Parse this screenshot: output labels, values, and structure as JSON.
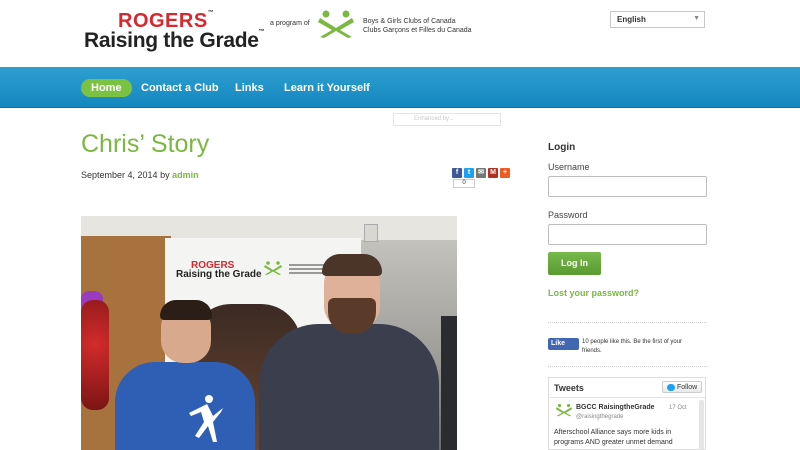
{
  "header": {
    "logo_rogers": "ROGERS",
    "logo_tm": "™",
    "logo_rtg": "Raising the Grade",
    "program_of": "a program of",
    "bgc_name_en": "Boys & Girls Clubs of Canada",
    "bgc_name_fr": "Clubs Garçons et Filles du Canada",
    "language": "English"
  },
  "nav": {
    "items": [
      {
        "label": "Home",
        "active": true
      },
      {
        "label": "Contact a Club",
        "active": false
      },
      {
        "label": "Links",
        "active": false
      },
      {
        "label": "Learn it Yourself",
        "active": false
      }
    ],
    "search_placeholder": "Enhanced by..."
  },
  "post": {
    "title": "Chris’ Story",
    "date": "September 4, 2014",
    "by": "by",
    "author": "admin",
    "share_count": "0",
    "share_icons": [
      {
        "name": "facebook-icon",
        "color": "#3b5998",
        "glyph": "f"
      },
      {
        "name": "twitter-icon",
        "color": "#1da1f2",
        "glyph": "t"
      },
      {
        "name": "email-icon",
        "color": "#777777",
        "glyph": "✉"
      },
      {
        "name": "gmail-icon",
        "color": "#b23121",
        "glyph": "M"
      },
      {
        "name": "more-icon",
        "color": "#f05a24",
        "glyph": "+"
      }
    ],
    "photo_banner_logo_rogers": "ROGERS",
    "photo_banner_logo_rtg": "Raising the Grade"
  },
  "sidebar": {
    "login_title": "Login",
    "username_label": "Username",
    "password_label": "Password",
    "login_button": "Log In",
    "lost_password": "Lost your password?",
    "fb_like": "Like",
    "fb_text": "10 people like this. Be the first of your friends.",
    "tweets": {
      "title": "Tweets",
      "follow": "Follow",
      "name": "BGCC RaisingtheGrade",
      "handle": "@raisingthegrade",
      "date": "17 Oct",
      "body": "Afterschool Alliance says more kids in programs AND greater unmet demand"
    }
  },
  "colors": {
    "accent_green": "#7ab840",
    "nav_blue": "#1c8fc6",
    "rogers_red": "#d7282f"
  }
}
